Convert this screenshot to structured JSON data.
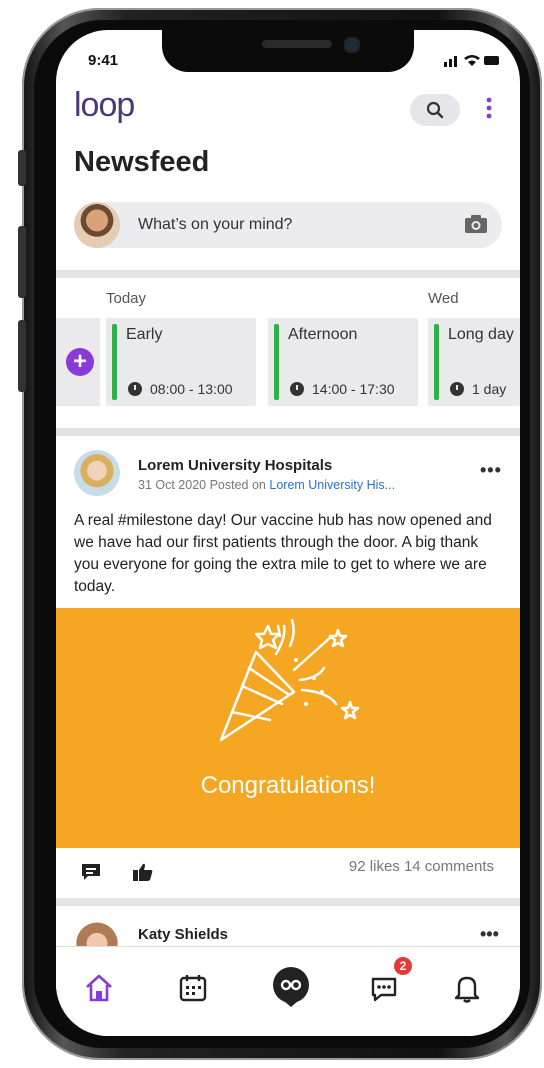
{
  "status_bar": {
    "time": "9:41"
  },
  "app": {
    "logo": "loop",
    "title": "Newsfeed"
  },
  "icons": {
    "search": "search-icon",
    "more": "more-vertical-icon",
    "camera": "camera-icon"
  },
  "compose": {
    "placeholder": "What’s on your mind?"
  },
  "shifts": {
    "day_today": "Today",
    "day_wed": "Wed",
    "items": [
      {
        "name": "Early",
        "time": "08:00 - 13:00"
      },
      {
        "name": "Afternoon",
        "time": "14:00 - 17:30"
      },
      {
        "name": "Long day",
        "time": "1 day"
      }
    ],
    "accent": "#2eb14b"
  },
  "post": {
    "author": "Lorem University Hospitals",
    "date": "31 Oct 2020",
    "posted_on_label": "Posted on",
    "posted_on": "Lorem University His...",
    "text": "A real #milestone day! Our vaccine hub has now opened and we have had our first patients through the door. A big thank you everyone for going the extra mile to get to where we are today.",
    "banner_text": "Congratulations!",
    "banner_color": "#f5a623",
    "likes": "92 likes",
    "comments": "14 comments"
  },
  "post2": {
    "author": "Katy Shields"
  },
  "tabbar": {
    "messages_badge": "2",
    "brand_color": "#8a3ad8"
  }
}
